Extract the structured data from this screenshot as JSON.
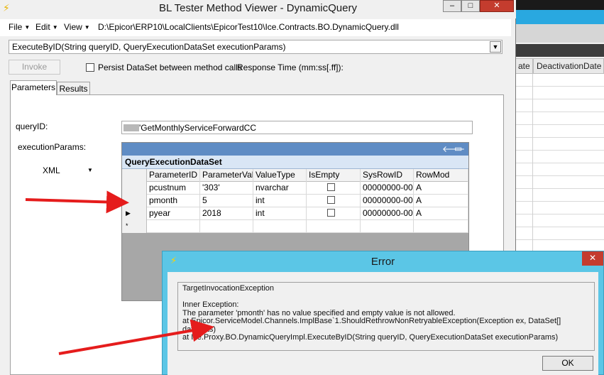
{
  "background_app": {
    "col_a": "ate",
    "col_b": "DeactivationDate"
  },
  "window": {
    "title": "BL Tester Method Viewer - DynamicQuery",
    "min_glyph": "–",
    "max_glyph": "□",
    "close_glyph": "✕"
  },
  "menu": {
    "items": [
      "File",
      "Edit",
      "View"
    ],
    "path": "D:\\Epicor\\ERP10\\LocalClients\\EpicorTest10\\Ice.Contracts.BO.DynamicQuery.dll"
  },
  "method": {
    "selected": "ExecuteByID(String queryID, QueryExecutionDataSet executionParams)"
  },
  "controls": {
    "invoke": "Invoke",
    "persist_label": "Persist DataSet between method calls",
    "response_time_label": "Response Time (mm:ss[.ff]):"
  },
  "tabs": [
    "Parameters",
    "Results"
  ],
  "params": {
    "query_id_label": "queryID:",
    "query_id_value": "'GetMonthlyServiceForwardCC",
    "execution_params_label": "executionParams:",
    "format": "XML"
  },
  "dataset": {
    "name": "QueryExecutionDataSet",
    "columns": [
      "ParameterID",
      "ParameterVal",
      "ValueType",
      "IsEmpty",
      "SysRowID",
      "RowMod"
    ],
    "rows": [
      {
        "ParameterID": "pcustnum",
        "ParameterVal": "'303'",
        "ValueType": "nvarchar",
        "IsEmpty": false,
        "SysRowID": "00000000-00",
        "RowMod": "A"
      },
      {
        "ParameterID": "pmonth",
        "ParameterVal": "5",
        "ValueType": "int",
        "IsEmpty": false,
        "SysRowID": "00000000-00",
        "RowMod": "A"
      },
      {
        "ParameterID": "pyear",
        "ParameterVal": "2018",
        "ValueType": "int",
        "IsEmpty": false,
        "SysRowID": "00000000-00",
        "RowMod": "A"
      }
    ],
    "current_row_marker": "▶",
    "new_row_marker": "*"
  },
  "error_dialog": {
    "title": "Error",
    "close_glyph": "✕",
    "lines": [
      "TargetInvocationException",
      "",
      "Inner Exception:",
      "The parameter 'pmonth' has no value specified and empty value is not allowed.",
      "   at Epicor.ServiceModel.Channels.ImplBase`1.ShouldRethrowNonRetryableException(Exception ex, DataSet[] dataSets)",
      "   at Ice.Proxy.BO.DynamicQueryImpl.ExecuteByID(String queryID, QueryExecutionDataSet executionParams)"
    ],
    "ok_label": "OK"
  },
  "colors": {
    "accent_blue": "#5bc6e6",
    "arrow_red": "#e51c1c"
  }
}
